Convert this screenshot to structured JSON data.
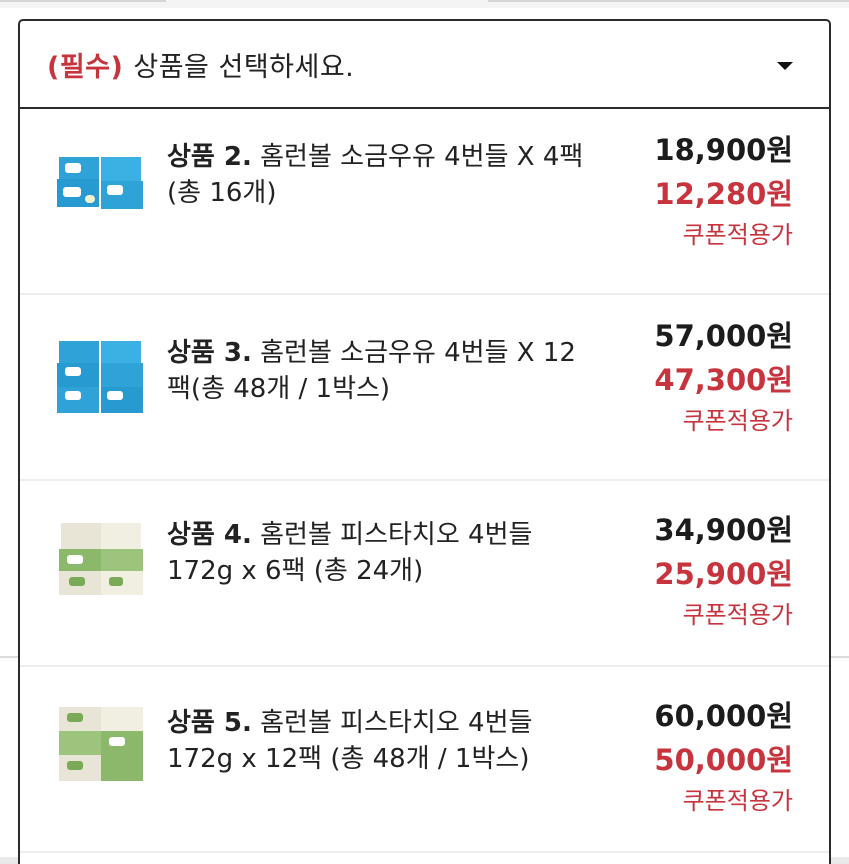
{
  "dropdown": {
    "required_label": "(필수)",
    "placeholder": "상품을 선택하세요."
  },
  "options": [
    {
      "number": "상품 2.",
      "title": "홈런볼 소금우유 4번들 X 4팩(총 16개)",
      "original_price": "18,900원",
      "sale_price": "12,280원",
      "coupon_label": "쿠폰적용가",
      "thumb_color": "#2fa3d8"
    },
    {
      "number": "상품 3.",
      "title": "홈런볼 소금우유 4번들 X 12팩(총 48개 / 1박스)",
      "original_price": "57,000원",
      "sale_price": "47,300원",
      "coupon_label": "쿠폰적용가",
      "thumb_color": "#2fa3d8"
    },
    {
      "number": "상품 4.",
      "title": "홈런볼 피스타치오 4번들 172g x 6팩 (총 24개)",
      "original_price": "34,900원",
      "sale_price": "25,900원",
      "coupon_label": "쿠폰적용가",
      "thumb_color": "#8bb86a"
    },
    {
      "number": "상품 5.",
      "title": "홈런볼 피스타치오 4번들 172g x 12팩 (총 48개 / 1박스)",
      "original_price": "60,000원",
      "sale_price": "50,000원",
      "coupon_label": "쿠폰적용가",
      "thumb_color": "#8bb86a"
    }
  ],
  "icons": {
    "dropdown": "caret-down-icon"
  }
}
